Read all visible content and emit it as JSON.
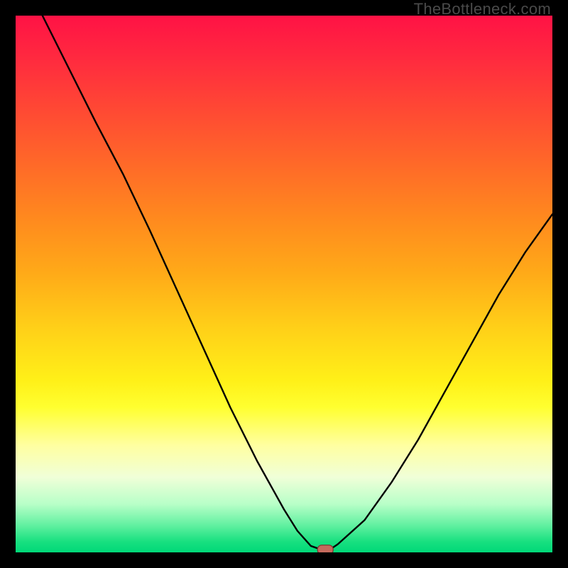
{
  "watermark": "TheBottleneck.com",
  "colors": {
    "frame": "#000000",
    "curve": "#000000",
    "marker_fill": "#c46a5d",
    "marker_stroke": "#7a3a33"
  },
  "chart_data": {
    "type": "line",
    "title": "",
    "xlabel": "",
    "ylabel": "",
    "xlim": [
      0,
      100
    ],
    "ylim": [
      0,
      100
    ],
    "grid": false,
    "legend": false,
    "series": [
      {
        "name": "bottleneck-curve",
        "x": [
          5,
          10,
          15,
          20,
          25,
          30,
          35,
          40,
          45,
          50,
          52.5,
          55,
          57,
          58.5,
          60,
          65,
          70,
          75,
          80,
          85,
          90,
          95,
          100
        ],
        "y": [
          100,
          90,
          80,
          70.5,
          60,
          49,
          38,
          27,
          17,
          8,
          4,
          1.2,
          0.5,
          0.5,
          1.5,
          6,
          13,
          21,
          30,
          39,
          48,
          56,
          63
        ]
      }
    ],
    "markers": [
      {
        "name": "optimal-point",
        "x": 57.7,
        "y": 0.5
      }
    ],
    "annotations": []
  }
}
